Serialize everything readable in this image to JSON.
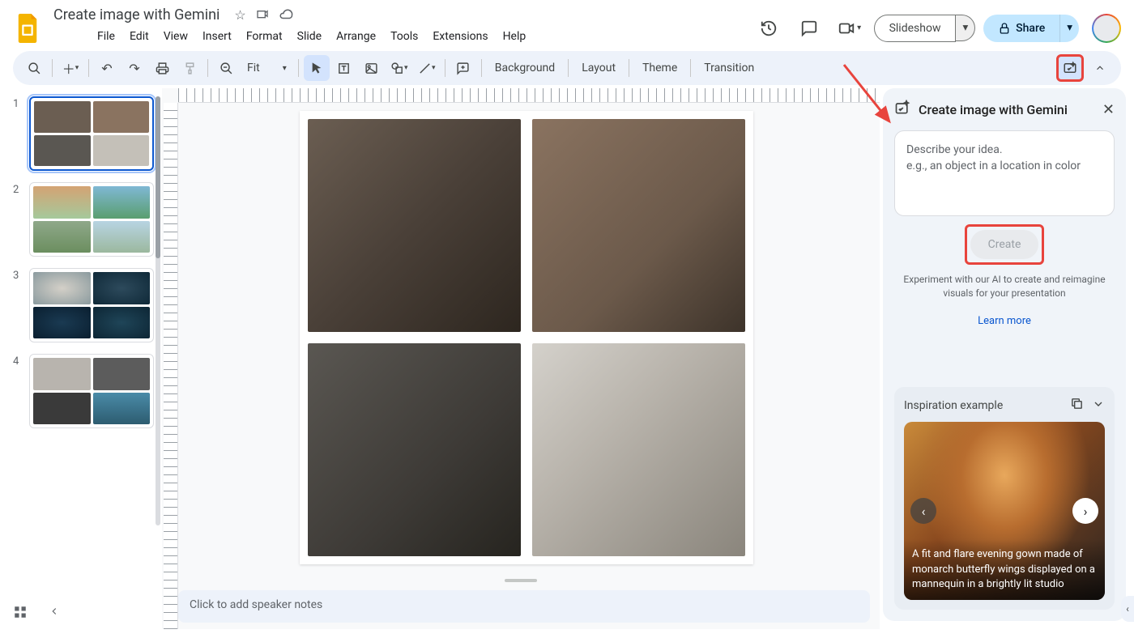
{
  "header": {
    "doc_title": "Create image with Gemini",
    "slideshow_label": "Slideshow",
    "share_label": "Share"
  },
  "menubar": [
    "File",
    "Edit",
    "View",
    "Insert",
    "Format",
    "Slide",
    "Arrange",
    "Tools",
    "Extensions",
    "Help"
  ],
  "toolbar": {
    "zoom": "Fit",
    "items": [
      "Background",
      "Layout",
      "Theme",
      "Transition"
    ]
  },
  "filmstrip": {
    "slides": [
      {
        "num": "1",
        "selected": true
      },
      {
        "num": "2",
        "selected": false
      },
      {
        "num": "3",
        "selected": false
      },
      {
        "num": "4",
        "selected": false
      }
    ]
  },
  "canvas": {
    "speaker_notes_placeholder": "Click to add speaker notes"
  },
  "sidepanel": {
    "title": "Create image with Gemini",
    "prompt_line1": "Describe your idea.",
    "prompt_line2": "e.g., an object in a location in color",
    "create_label": "Create",
    "desc": "Experiment with our AI to create and reimagine visuals for your presentation",
    "learn_more": "Learn more",
    "inspiration_label": "Inspiration example",
    "inspiration_caption": "A fit and flare evening gown made of monarch butterfly wings displayed on a mannequin in a brightly lit studio"
  }
}
